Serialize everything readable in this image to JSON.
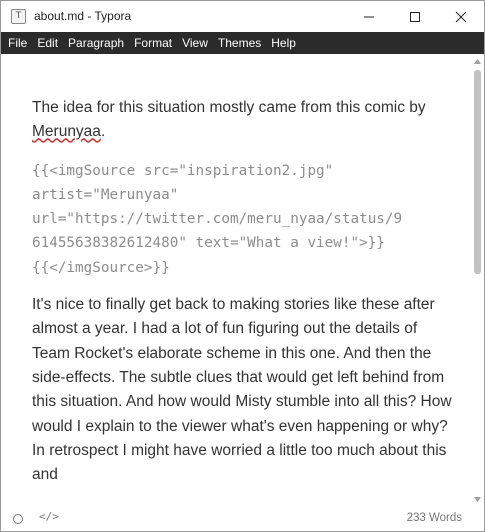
{
  "window": {
    "title": "about.md - Typora",
    "app_icon_letter": "T"
  },
  "menu": {
    "items": [
      "File",
      "Edit",
      "Paragraph",
      "Format",
      "View",
      "Themes",
      "Help"
    ]
  },
  "document": {
    "paragraph1_text": "The idea for this situation mostly came from this comic by ",
    "paragraph1_link": "Merunyaa",
    "paragraph1_end": ".",
    "code_lines": [
      "{{<imgSource src=\"inspiration2.jpg\"",
      "artist=\"Merunyaa\"",
      "url=\"https://twitter.com/meru_nyaa/status/9",
      "61455638382612480\" text=\"What a view!\">}}",
      "{{</imgSource>}}"
    ],
    "paragraph2": "It's nice to finally get back to making stories like these after almost a year.  I had a lot of fun figuring out the details of Team Rocket's elaborate scheme in this one.  And then the side-effects. The subtle clues that would get left behind from this situation.  And how would Misty stumble into all this?  How would I explain to the viewer what's even happening or why? In retrospect I might have worried a little too much about this and"
  },
  "status": {
    "source_toggle": "</>",
    "word_count": "233 Words"
  },
  "colors": {
    "menubar_bg": "#2b2b2b",
    "text": "#333333",
    "code_text": "#8d8d8d",
    "spellcheck_underline": "#d03030"
  },
  "icons": {
    "minimize": "minimize-icon",
    "maximize": "maximize-icon",
    "close": "close-icon",
    "status_outline": "circle-outline-icon",
    "source_code": "code-icon"
  }
}
